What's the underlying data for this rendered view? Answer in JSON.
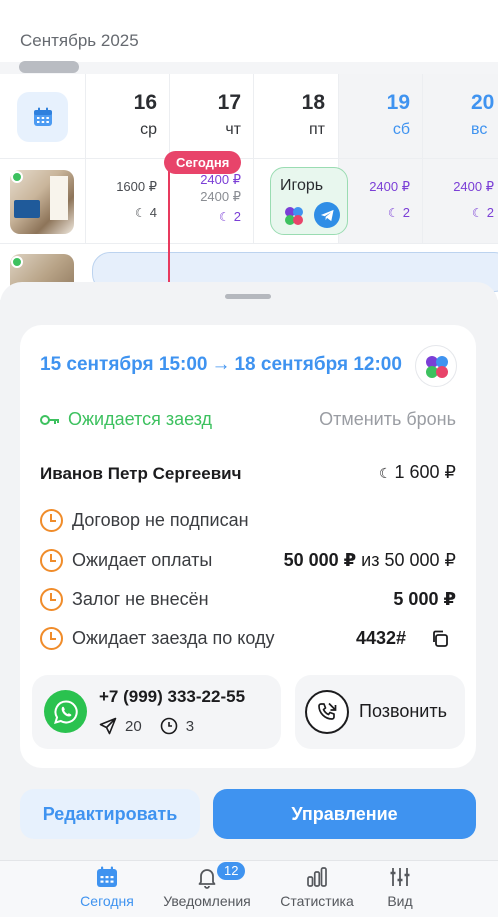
{
  "calendar": {
    "month": "Сентябрь 2025",
    "days": [
      {
        "num": "16",
        "wd": "ср",
        "weekend": false
      },
      {
        "num": "17",
        "wd": "чт",
        "weekend": false
      },
      {
        "num": "18",
        "wd": "пт",
        "weekend": false
      },
      {
        "num": "19",
        "wd": "сб",
        "weekend": true
      },
      {
        "num": "20",
        "wd": "вс",
        "weekend": true
      }
    ],
    "today_label": "Сегодня",
    "row1": {
      "c16": {
        "price": "1600 ₽",
        "nights": "4"
      },
      "c17": {
        "price": "2400 ₽",
        "price_old": "2400 ₽",
        "nights": "2"
      },
      "c19": {
        "price": "2400 ₽",
        "nights": "2"
      },
      "c20": {
        "price": "2400 ₽",
        "nights": "2"
      },
      "booking_name": "Игорь"
    }
  },
  "booking": {
    "date_from": "15 сентября 15:00",
    "arrow": "→",
    "date_to": "18 сентября 12:00",
    "status": "Ожидается заезд",
    "cancel_label": "Отменить бронь",
    "guest_name": "Иванов Петр Сергеевич",
    "guest_price": "1 600 ₽",
    "items": [
      {
        "label": "Договор не подписан"
      },
      {
        "label": "Ожидает оплаты",
        "value": "50 000 ₽",
        "value_suffix": " из 50 000 ₽"
      },
      {
        "label": "Залог не внесён",
        "value": "5 000 ₽"
      },
      {
        "label": "Ожидает заезда по коду",
        "value": "4432#"
      }
    ],
    "contact": {
      "phone": "+7 (999) 333-22-55",
      "messages": "20",
      "pending": "3"
    },
    "call_label": "Позвонить",
    "edit_label": "Редактировать",
    "manage_label": "Управление"
  },
  "tabbar": {
    "today": "Сегодня",
    "notifications": "Уведомления",
    "notifications_count": "12",
    "stats": "Статистика",
    "view": "Вид"
  },
  "colors": {
    "accent": "#3f93f0",
    "success": "#3dc15f",
    "warning": "#f08c2a",
    "today": "#e8446a",
    "purple": "#7b3fd6"
  }
}
